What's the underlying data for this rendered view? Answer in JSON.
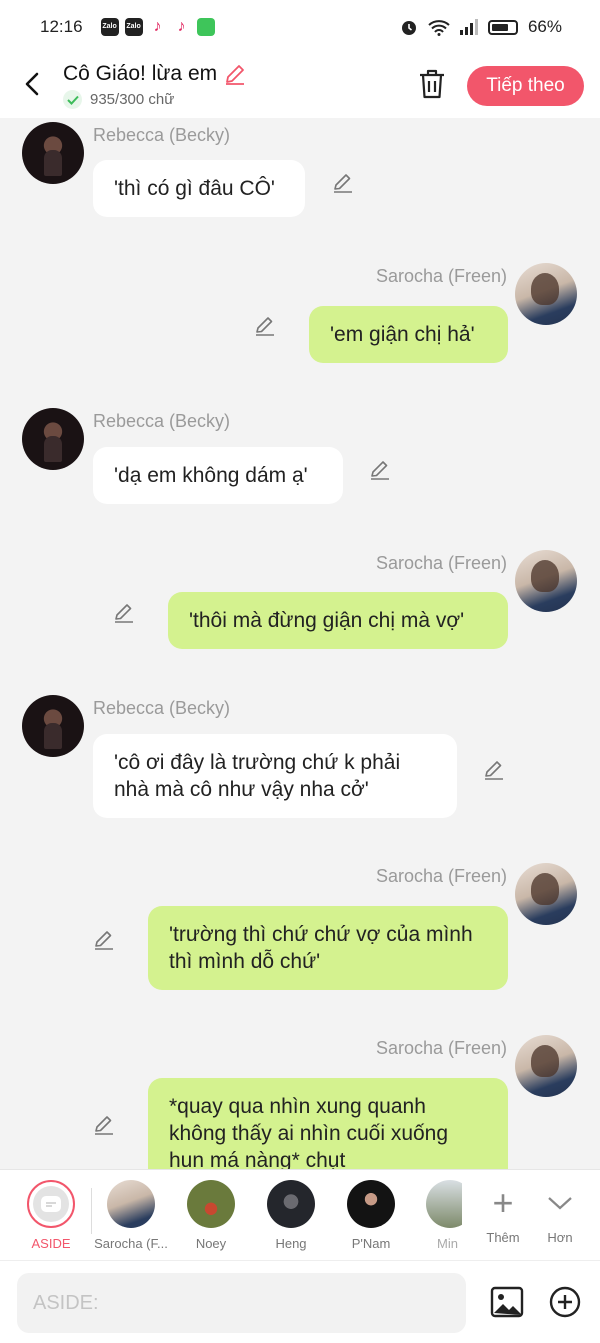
{
  "status_bar": {
    "time": "12:16",
    "apps": [
      "Zalo",
      "Zalo"
    ],
    "battery": "66%"
  },
  "header": {
    "title": "Cô Giáo! lừa em",
    "word_count": "935/300 chữ",
    "next_label": "Tiếp theo"
  },
  "messages": [
    {
      "side": "left",
      "sender": "Rebecca (Becky)",
      "text": "'thì có gì đâu CÔ'"
    },
    {
      "side": "right",
      "sender": "Sarocha (Freen)",
      "text": "'em giận chị hả'"
    },
    {
      "side": "left",
      "sender": "Rebecca (Becky)",
      "text": "'dạ em không dám ạ'"
    },
    {
      "side": "right",
      "sender": "Sarocha (Freen)",
      "text": "'thôi mà đừng giận chị mà vợ'"
    },
    {
      "side": "left",
      "sender": "Rebecca (Becky)",
      "text": "'cô ơi đây là trường chứ k phải nhà mà cô như vậy nha cở'"
    },
    {
      "side": "right",
      "sender": "Sarocha (Freen)",
      "text": "'trường thì chứ chứ vợ của mình thì mình dỗ chứ'"
    },
    {
      "side": "right",
      "sender": "Sarocha (Freen)",
      "text": "*quay qua nhìn xung quanh không thấy ai nhìn cuối xuống hun má nàng* chụt"
    }
  ],
  "characters": {
    "aside": "ASIDE",
    "list": [
      "Sarocha (F...",
      "Noey",
      "Heng",
      "P'Nam",
      "Min"
    ],
    "add_label": "Thêm",
    "more_label": "Hơn"
  },
  "composer": {
    "placeholder": "ASIDE:"
  },
  "colors": {
    "accent": "#f2566b",
    "bubble_self": "#d4f28f",
    "bubble_other": "#ffffff",
    "background": "#f3f3f3"
  }
}
